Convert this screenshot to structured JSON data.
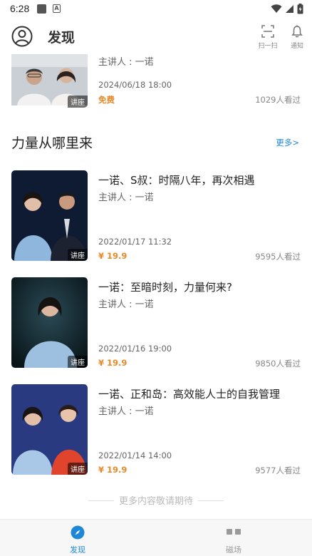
{
  "status_bar": {
    "time": "6:28",
    "a_badge": "A"
  },
  "header": {
    "title": "发现",
    "scan_label": "扫一扫",
    "notify_label": "通知"
  },
  "top_item": {
    "speaker": "主讲人 : 一诺",
    "date": "2024/06/18 18:00",
    "price": "免费",
    "views": "1029人看过",
    "tag": "讲座"
  },
  "section": {
    "title": "力量从哪里来",
    "more": "更多>"
  },
  "courses": [
    {
      "title": "一诺、S叔：时隔八年，再次相遇",
      "speaker": "主讲人 : 一诺",
      "date": "2022/01/17 11:32",
      "price": "¥ 19.9",
      "views": "9595人看过",
      "tag": "讲座"
    },
    {
      "title": "一诺：至暗时刻，力量何来?",
      "speaker": "主讲人 : 一诺",
      "date": "2022/01/16 19:00",
      "price": "¥ 19.9",
      "views": "9850人看过",
      "tag": "讲座"
    },
    {
      "title": "一诺、正和岛：高效能人士的自我管理",
      "speaker": "主讲人 : 一诺",
      "date": "2022/01/14 14:00",
      "price": "¥ 19.9",
      "views": "9577人看过",
      "tag": "讲座"
    }
  ],
  "footer_note": "更多内容敬请期待",
  "bottom_nav": {
    "discover": "发现",
    "field": "磁场"
  },
  "colors": {
    "accent": "#1f88d6",
    "price": "#e88a2a"
  },
  "icons": [
    "user-circle-icon",
    "scan-icon",
    "bell-icon",
    "compass-icon",
    "grid-icon",
    "wifi-icon",
    "signal-icon",
    "battery-icon"
  ]
}
